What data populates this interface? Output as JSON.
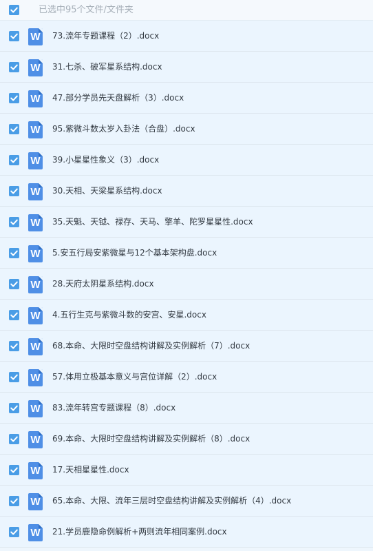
{
  "header": {
    "select_text": "已选中95个文件/文件夹"
  },
  "files": [
    {
      "name": "73.流年专题课程（2）.docx",
      "icon": "W"
    },
    {
      "name": "31.七杀、破军星系结构.docx",
      "icon": "W"
    },
    {
      "name": "47.部分学员先天盘解析（3）.docx",
      "icon": "W"
    },
    {
      "name": "95.紫微斗数太岁入卦法（合盘）.docx",
      "icon": "W"
    },
    {
      "name": "39.小星星性象义（3）.docx",
      "icon": "W"
    },
    {
      "name": "30.天相、天梁星系结构.docx",
      "icon": "W"
    },
    {
      "name": "35.天魁、天钺、禄存、天马、擎羊、陀罗星星性.docx",
      "icon": "W"
    },
    {
      "name": "5.安五行局安紫微星与12个基本架构盘.docx",
      "icon": "W"
    },
    {
      "name": "28.天府太阴星系结构.docx",
      "icon": "W"
    },
    {
      "name": "4.五行生克与紫微斗数的安宫、安星.docx",
      "icon": "W"
    },
    {
      "name": "68.本命、大限时空盘结构讲解及实例解析（7）.docx",
      "icon": "W"
    },
    {
      "name": "57.体用立极基本意义与宫位详解（2）.docx",
      "icon": "W"
    },
    {
      "name": "83.流年转宫专题课程（8）.docx",
      "icon": "W"
    },
    {
      "name": "69.本命、大限时空盘结构讲解及实例解析（8）.docx",
      "icon": "W"
    },
    {
      "name": "17.天相星星性.docx",
      "icon": "W"
    },
    {
      "name": "65.本命、大限、流年三层时空盘结构讲解及实例解析（4）.docx",
      "icon": "W"
    },
    {
      "name": "21.学员鹿隐命例解析+两则流年相同案例.docx",
      "icon": "W"
    }
  ],
  "icons": {
    "checkbox": "checkbox-checked-icon",
    "file": "word-doc-icon"
  },
  "colors": {
    "checkbox": "#4a9de6",
    "word_icon": "#4f8fe6",
    "row_background": "#ebf5fe",
    "header_text": "#a7b0b9",
    "file_text": "#333a42"
  }
}
